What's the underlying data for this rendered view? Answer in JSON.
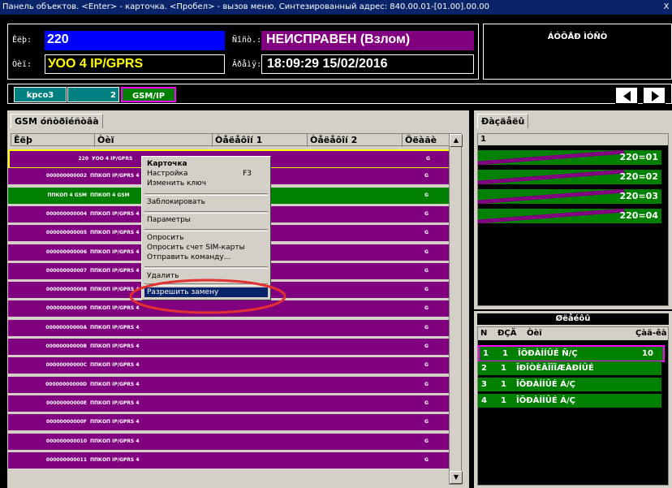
{
  "window": {
    "title": "Панель объектов. <Enter> - карточка. <Пробел> - вызов меню. Синтезированный адрес: 840.00.01-[01.00].00.00",
    "close": "X"
  },
  "info": {
    "number_label": "Êëþ:",
    "number_value": "220",
    "status_label": "Ñîñò.:",
    "status_value": "НЕИСПРАВЕН (Взлом)",
    "type_label": "Òèï:",
    "type_value": "УОО 4 IP/GPRS",
    "time_label": "Âðåìÿ:",
    "time_value": "18:09:29 15/02/2016"
  },
  "right_panel": {
    "title": "ÁÓÔÅÐ ÌÓÑÒ"
  },
  "tabs": {
    "first": "kpco3",
    "second": "2",
    "third": "GSM/IP"
  },
  "nav": {
    "prev": "◀",
    "next": "▶"
  },
  "grid": {
    "tab": "GSM óñòðîéñòâà",
    "columns": [
      "Êëþ",
      "Òèï",
      "Òåëåôîí 1",
      "Òåëåôîí 2",
      "Ôëàãè"
    ],
    "rows": [
      {
        "num": "220",
        "type": "УОО 4 IP/GPRS",
        "flag": "G",
        "color": "#800080",
        "selected": true
      },
      {
        "num": "000000000002",
        "type": "ППКОП IP/GPRS 4",
        "flag": "G",
        "color": "#800080"
      },
      {
        "num": "ППКОП 4 GSM",
        "type": "ППКОП 4 GSM",
        "flag": "G",
        "color": "#008000"
      },
      {
        "num": "000000000004",
        "type": "ППКОП IP/GPRS 4",
        "flag": "G",
        "color": "#800080"
      },
      {
        "num": "000000000005",
        "type": "ППКОП IP/GPRS 4",
        "flag": "G",
        "color": "#800080"
      },
      {
        "num": "000000000006",
        "type": "ППКОП IP/GPRS 4",
        "flag": "G",
        "color": "#800080"
      },
      {
        "num": "000000000007",
        "type": "ППКОП IP/GPRS 4",
        "flag": "G",
        "color": "#800080"
      },
      {
        "num": "000000000008",
        "type": "ППКОП IP/GPRS 4",
        "flag": "G",
        "color": "#800080"
      },
      {
        "num": "000000000009",
        "type": "ППКОП IP/GPRS 4",
        "flag": "G",
        "color": "#800080"
      },
      {
        "num": "00000000000A",
        "type": "ППКОП IP/GPRS 4",
        "flag": "G",
        "color": "#800080"
      },
      {
        "num": "00000000000B",
        "type": "ППКОП IP/GPRS 4",
        "flag": "G",
        "color": "#800080"
      },
      {
        "num": "00000000000C",
        "type": "ППКОП IP/GPRS 4",
        "flag": "G",
        "color": "#800080"
      },
      {
        "num": "00000000000D",
        "type": "ППКОП IP/GPRS 4",
        "flag": "G",
        "color": "#800080"
      },
      {
        "num": "00000000000E",
        "type": "ППКОП IP/GPRS 4",
        "flag": "G",
        "color": "#800080"
      },
      {
        "num": "00000000000F",
        "type": "ППКОП IP/GPRS 4",
        "flag": "G",
        "color": "#800080"
      },
      {
        "num": "000000000010",
        "type": "ППКОП IP/GPRS 4",
        "flag": "G",
        "color": "#800080"
      },
      {
        "num": "000000000011",
        "type": "ППКОП IP/GPRS 4",
        "flag": "G",
        "color": "#800080"
      }
    ]
  },
  "zones": {
    "tab": "Ðàçäåëû",
    "header": "1",
    "items": [
      "220=01",
      "220=02",
      "220=03",
      "220=04"
    ]
  },
  "loops": {
    "title": "Øëåéôû",
    "columns": [
      "N",
      "ÐÇÄ",
      "Òèï",
      "Çàä-êà"
    ],
    "items": [
      {
        "n": "1",
        "rzd": "1",
        "type": "ÎÕÐÀÍÍÛÉ Ñ/Ç",
        "delay": "10"
      },
      {
        "n": "2",
        "rzd": "1",
        "type": "ÏÐÎÒÈÂÎÏÎÆÀÐÍÛÉ",
        "delay": ""
      },
      {
        "n": "3",
        "rzd": "1",
        "type": "ÎÕÐÀÍÍÛÉ Á/Ç",
        "delay": ""
      },
      {
        "n": "4",
        "rzd": "1",
        "type": "ÎÕÐÀÍÍÛÉ Á/Ç",
        "delay": ""
      }
    ]
  },
  "context_menu": {
    "card": "Карточка",
    "settings": "Настройка",
    "settings_key": "F3",
    "change_key": "Изменить ключ",
    "block": "Заблокировать",
    "params": "Параметры",
    "poll": "Опросить",
    "poll_sim": "Опросить счет SIM-карты",
    "send_cmd": "Отправить команду...",
    "delete": "Удалить",
    "allow_replace": "Разрешить замену"
  },
  "colors": {
    "purple": "#800080",
    "green": "#008000",
    "teal": "#008080",
    "blue": "#0000ff",
    "yellow": "#ffff00",
    "highlight": "#e03030"
  }
}
